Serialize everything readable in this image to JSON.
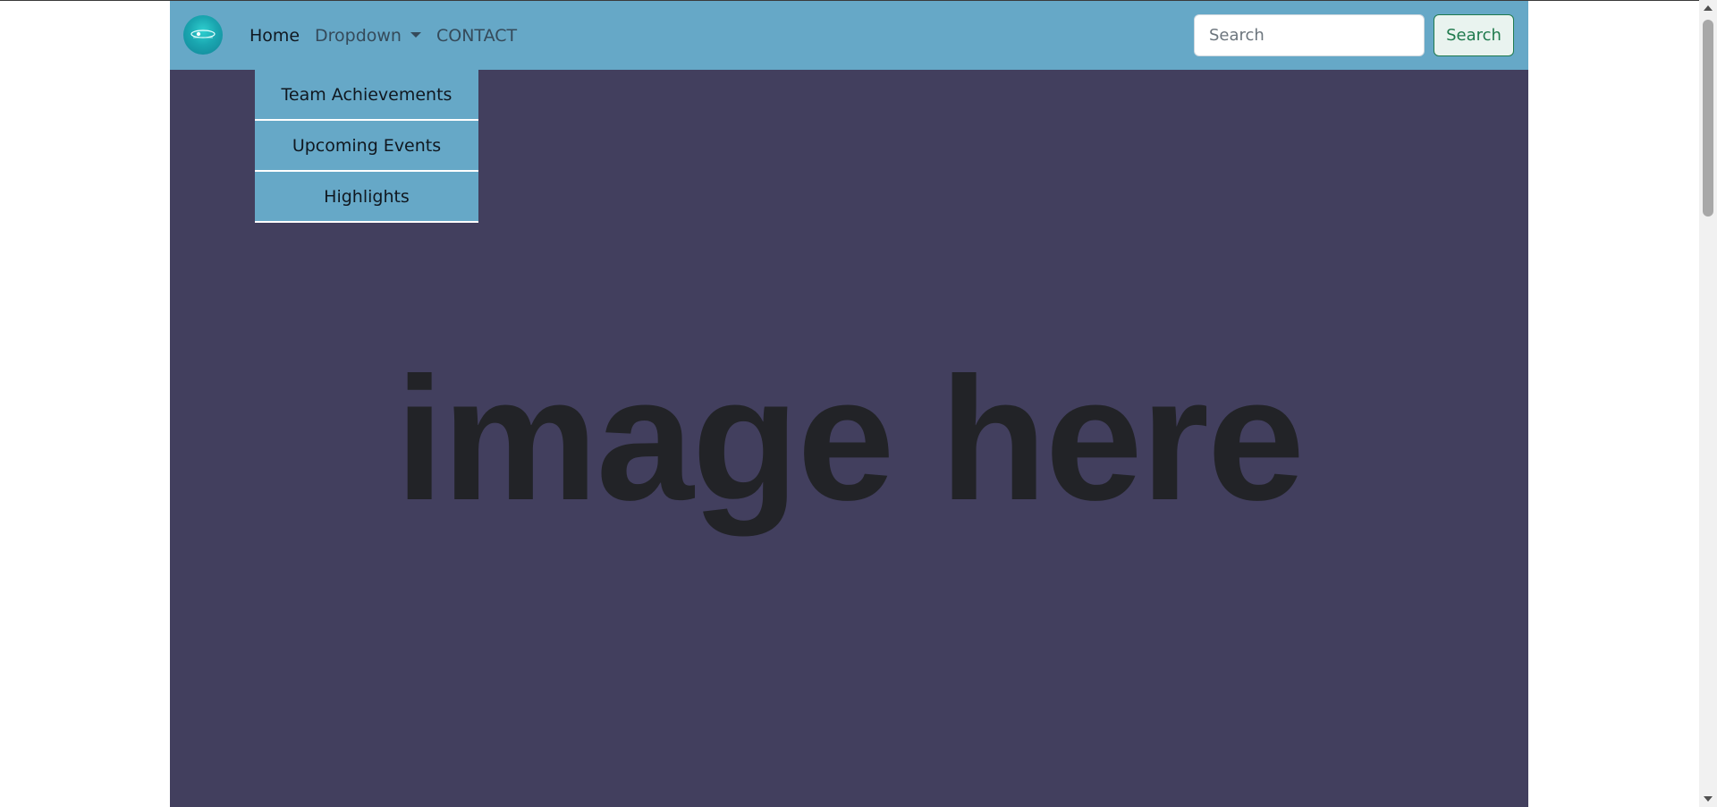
{
  "navbar": {
    "logo_name": "logo-icon",
    "links": {
      "home": "Home",
      "dropdown": "Dropdown",
      "contact": "CONTACT"
    },
    "search": {
      "placeholder": "Search",
      "button_label": "Search"
    }
  },
  "dropdown_menu": {
    "items": [
      "Team Achievements",
      "Upcoming Events",
      "Highlights"
    ]
  },
  "hero": {
    "placeholder_text": "image here"
  },
  "colors": {
    "navbar_bg": "#66a8c7",
    "page_bg": "#423f5e",
    "button_accent": "#1f7a4d"
  }
}
